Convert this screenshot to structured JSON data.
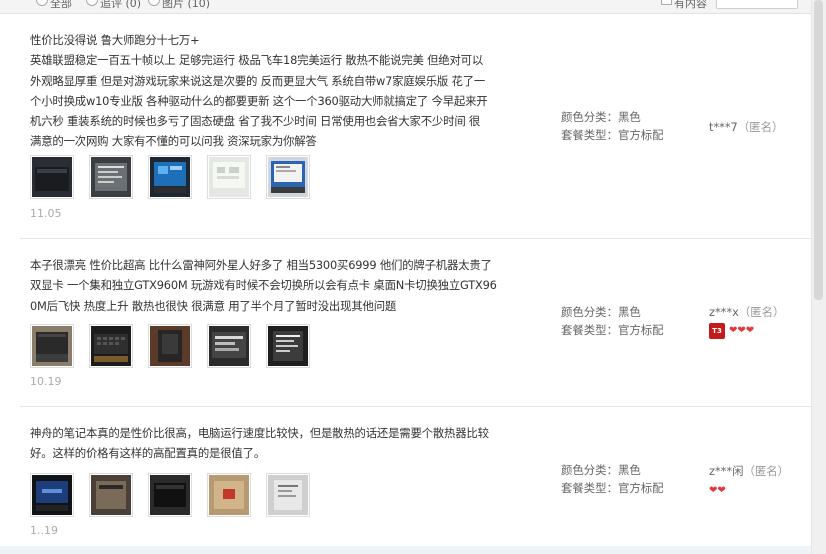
{
  "toolbar": {
    "filters": [
      "全部",
      "追评 (0)",
      "图片 (10)"
    ],
    "checkbox_label": "有内容",
    "select_value": ""
  },
  "labels": {
    "color_label": "颜色分类：",
    "package_label": "套餐类型："
  },
  "reviews": [
    {
      "lines": [
        "性价比没得说 鲁大师跑分十七万+",
        "英雄联盟稳定一百五十帧以上 足够完运行 极品飞车18完美运行 散热不能说完美 但绝对可以",
        "外观略显厚重 但是对游戏玩家来说这是次要的 反而更显大气 系统自带w7家庭娱乐版 花了一",
        "个小时换成w10专业版 各种驱动什么的都要更新 这个一个360驱动大师就搞定了 今早起来开",
        "机六秒 重装系统的时候也多亏了固态硬盘 省了我不少时间 日常使用也会省大家不少时间 很",
        "满意的一次网购 大家有不懂的可以问我 资深玩家为你解答"
      ],
      "date": "11.05",
      "color": "黑色",
      "package": "官方标配",
      "user": "t***7",
      "anon": "（匿名）",
      "thumbs": [
        "laptop-dark",
        "label-plate",
        "screen-blue",
        "screen-white",
        "screen-desktop"
      ]
    },
    {
      "lines": [
        "本子很漂亮 性价比超高 比什么雷神阿外星人好多了 相当5300买6999 他们的牌子机器太贵了",
        "双显卡 一个集和独立GTX960M 玩游戏有时候不会切换所以会有点卡 桌面N卡切换独立GTX96",
        "0M后飞快 热度上升 散热也很快 很满意 用了半个月了暂时没出现其他问题"
      ],
      "date": "10.19",
      "color": "黑色",
      "package": "官方标配",
      "user": "z***x",
      "anon": "（匿名）",
      "badge": "T3",
      "hearts": "❤❤❤",
      "thumbs": [
        "laptop-open",
        "laptop-keyboard",
        "box-dark",
        "laptop-side",
        "label-sticker"
      ]
    },
    {
      "lines": [
        "神舟的笔记本真的是性价比很高，电脑运行速度比较快，但是散热的话还是需要个散热器比较",
        "好。这样的价格有这样的高配置真的是很值了。"
      ],
      "date": "1..19",
      "color": "黑色",
      "package": "官方标配",
      "user": "z***闲",
      "anon": "（匿名）",
      "hearts": "❤❤",
      "thumbs": [
        "laptop-boot",
        "box-brown",
        "laptop-dark2",
        "box-package",
        "label-card"
      ]
    }
  ]
}
